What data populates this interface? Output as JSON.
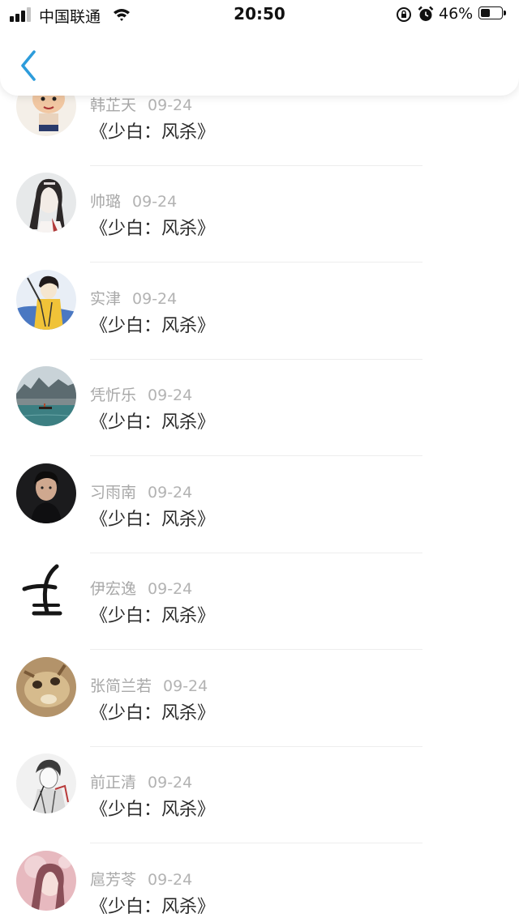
{
  "status_bar": {
    "carrier": "中国联通",
    "time": "20:50",
    "battery_percent": "46%",
    "battery_level": 0.46,
    "icons": [
      "signal-icon",
      "wifi-icon",
      "rotation-lock-icon",
      "alarm-icon",
      "battery-icon"
    ]
  },
  "header": {
    "back_icon": "chevron-left-icon",
    "accent_color": "#2d9cdb"
  },
  "comments": [
    {
      "name": "韩芷天",
      "date": "09-24",
      "text": "《少白：风杀》",
      "avatar": "cartoon-boy"
    },
    {
      "name": "帅璐",
      "date": "09-24",
      "text": "《少白：风杀》",
      "avatar": "girl-sketch"
    },
    {
      "name": "实津",
      "date": "09-24",
      "text": "《少白：风杀》",
      "avatar": "girl-yellow"
    },
    {
      "name": "凭忻乐",
      "date": "09-24",
      "text": "《少白：风杀》",
      "avatar": "misty-landscape"
    },
    {
      "name": "习雨南",
      "date": "09-24",
      "text": "《少白：风杀》",
      "avatar": "man-photo"
    },
    {
      "name": "伊宏逸",
      "date": "09-24",
      "text": "《少白：风杀》",
      "avatar": "calligraphy"
    },
    {
      "name": "张简兰若",
      "date": "09-24",
      "text": "《少白：风杀》",
      "avatar": "cat"
    },
    {
      "name": "前正清",
      "date": "09-24",
      "text": "《少白：风杀》",
      "avatar": "boy-sketch"
    },
    {
      "name": "扈芳苓",
      "date": "09-24",
      "text": "《少白：风杀》",
      "avatar": "girl-pink"
    }
  ]
}
